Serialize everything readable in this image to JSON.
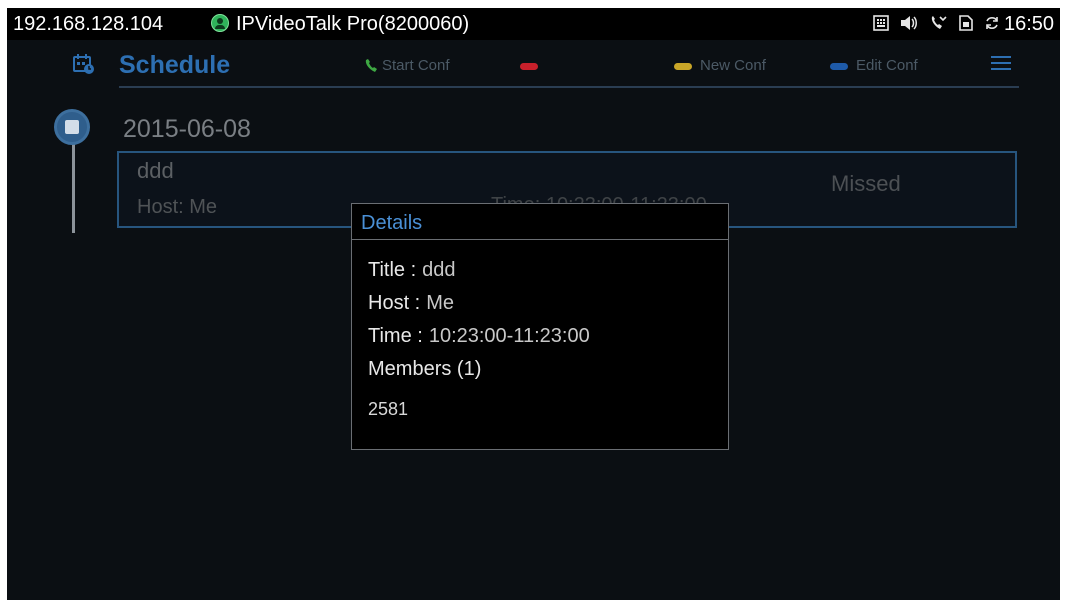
{
  "statusbar": {
    "ip": "192.168.128.104",
    "app_name": "IPVideoTalk Pro(8200060)",
    "time": "16:50",
    "icons": [
      "keypad-icon",
      "volume-icon",
      "missed-call-icon",
      "sim-icon",
      "sync-icon"
    ]
  },
  "header": {
    "title": "Schedule",
    "legend": [
      {
        "label": "Start Conf",
        "color": "#3ea843",
        "icon": "phone-icon"
      },
      {
        "label": "",
        "color": "#c8202b"
      },
      {
        "label": "New Conf",
        "color": "#c9a628"
      },
      {
        "label": "Edit Conf",
        "color": "#1e5aa8"
      }
    ]
  },
  "timeline": {
    "date": "2015-06-08"
  },
  "conference": {
    "title": "ddd",
    "host": "Host: Me",
    "time": "Time: 10:23:00-11:23:00",
    "status": "Missed"
  },
  "dialog": {
    "header": "Details",
    "title_label": "Title :",
    "title_value": "ddd",
    "host_label": "Host :",
    "host_value": "Me",
    "time_label": "Time :",
    "time_value": "10:23:00-11:23:00",
    "members_label": "Members (1)",
    "members": [
      "2581"
    ]
  }
}
